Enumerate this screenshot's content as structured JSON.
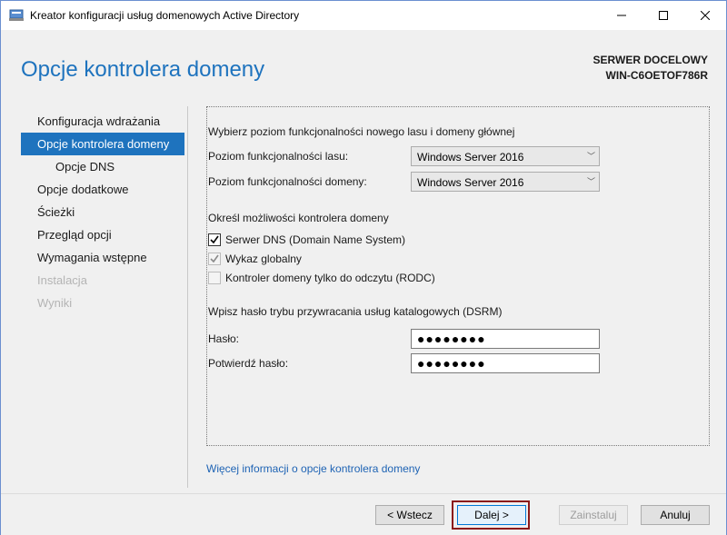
{
  "window": {
    "title": "Kreator konfiguracji usług domenowych Active Directory",
    "icon": "server-icon",
    "controls": {
      "minimize": "–",
      "maximize": "☐",
      "close": "✕"
    }
  },
  "header": {
    "page_title": "Opcje kontrolera domeny",
    "server_caption": "SERWER DOCELOWY",
    "server_name": "WIN-C6OETOF786R"
  },
  "sidebar": {
    "items": [
      {
        "label": "Konfiguracja wdrażania",
        "state": "normal"
      },
      {
        "label": "Opcje kontrolera domeny",
        "state": "active"
      },
      {
        "label": "Opcje DNS",
        "state": "sub"
      },
      {
        "label": "Opcje dodatkowe",
        "state": "normal"
      },
      {
        "label": "Ścieżki",
        "state": "normal"
      },
      {
        "label": "Przegląd opcji",
        "state": "normal"
      },
      {
        "label": "Wymagania wstępne",
        "state": "normal"
      },
      {
        "label": "Instalacja",
        "state": "disabled"
      },
      {
        "label": "Wyniki",
        "state": "disabled"
      }
    ]
  },
  "main": {
    "functional_level_heading": "Wybierz poziom funkcjonalności nowego lasu i domeny głównej",
    "forest_level_label": "Poziom funkcjonalności lasu:",
    "forest_level_value": "Windows Server 2016",
    "domain_level_label": "Poziom funkcjonalności domeny:",
    "domain_level_value": "Windows Server 2016",
    "capabilities_heading": "Określ możliwości kontrolera domeny",
    "capabilities": [
      {
        "label": "Serwer DNS (Domain Name System)",
        "checked": true,
        "enabled": true
      },
      {
        "label": "Wykaz globalny",
        "checked": true,
        "enabled": false
      },
      {
        "label": "Kontroler domeny tylko do odczytu (RODC)",
        "checked": false,
        "enabled": false
      }
    ],
    "dsrm_heading": "Wpisz hasło trybu przywracania usług katalogowych (DSRM)",
    "password_label": "Hasło:",
    "password_value": "●●●●●●●●",
    "confirm_label": "Potwierdź hasło:",
    "confirm_value": "●●●●●●●●",
    "more_info_link": "Więcej informacji o opcje kontrolera domeny"
  },
  "footer": {
    "back_label": "< Wstecz",
    "next_label": "Dalej >",
    "install_label": "Zainstaluj",
    "cancel_label": "Anuluj"
  },
  "colors": {
    "accent": "#1e73be",
    "link": "#1e63b4",
    "highlight_frame": "#8b1a1a"
  }
}
